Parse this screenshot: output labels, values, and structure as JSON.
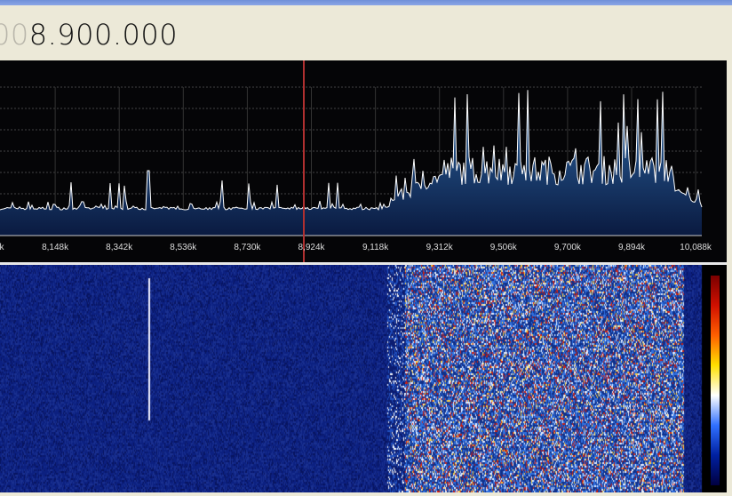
{
  "window": {
    "title_bar_color": "#7b98dd"
  },
  "frequency_display": {
    "dim_prefix": "00",
    "value": "8.900.000"
  },
  "spectrum": {
    "axis_ticks": [
      "k",
      "8,148k",
      "8,342k",
      "8,536k",
      "8,730k",
      "8,924k",
      "9,118k",
      "9,312k",
      "9,506k",
      "9,700k",
      "9,894k",
      "10,088k"
    ],
    "center_marker_color": "#b03030",
    "trace_color": "#ffffff",
    "fill_color": "#1e4a8a"
  },
  "waterfall": {
    "palette": [
      "#7a0000",
      "#d01000",
      "#ff6000",
      "#ffe000",
      "#ffffff",
      "#3070ff",
      "#0020a0",
      "#000040"
    ]
  }
}
